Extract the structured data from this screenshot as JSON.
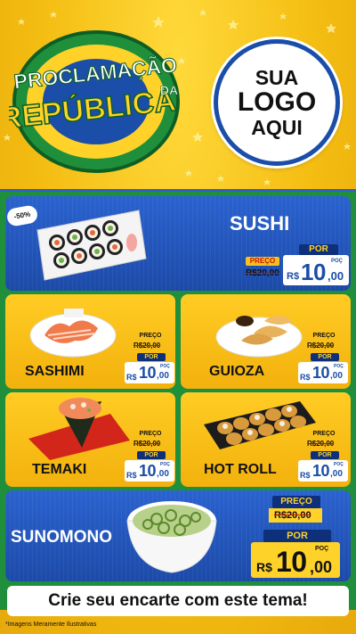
{
  "header": {
    "title_line1": "PROCLAMAÇÃO",
    "title_line2": "REPÚBLICA",
    "title_da": "DA",
    "logo_line1": "SUA",
    "logo_line2": "LOGO",
    "logo_line3": "AQUI"
  },
  "promo_badge": "-50%",
  "items": [
    {
      "name": "SUSHI",
      "old_price": "R$20,00",
      "price_int": "10",
      "price_cents": ",00"
    },
    {
      "name": "SASHIMI",
      "old_price": "R$20,00",
      "price_int": "10",
      "price_cents": ",00"
    },
    {
      "name": "GUIOZA",
      "old_price": "R$20,00",
      "price_int": "10",
      "price_cents": ",00"
    },
    {
      "name": "TEMAKI",
      "old_price": "R$20,00",
      "price_int": "10",
      "price_cents": ",00"
    },
    {
      "name": "HOT ROLL",
      "old_price": "R$20,00",
      "price_int": "10",
      "price_cents": ",00"
    },
    {
      "name": "SUNOMONO",
      "old_price": "R$20,00",
      "price_int": "10",
      "price_cents": ",00"
    }
  ],
  "labels": {
    "preco": "PREÇO",
    "por": "POR",
    "currency": "R$",
    "poc": "POÇ"
  },
  "footer": {
    "cta": "Crie seu encarte com este tema!",
    "disclaimer": "*Imagens Meramente Ilustrativas"
  },
  "colors": {
    "brand_yellow": "#f6c21a",
    "brand_blue": "#1b4ea8",
    "brand_green": "#1f8f3c",
    "price_red": "#c9140f"
  }
}
